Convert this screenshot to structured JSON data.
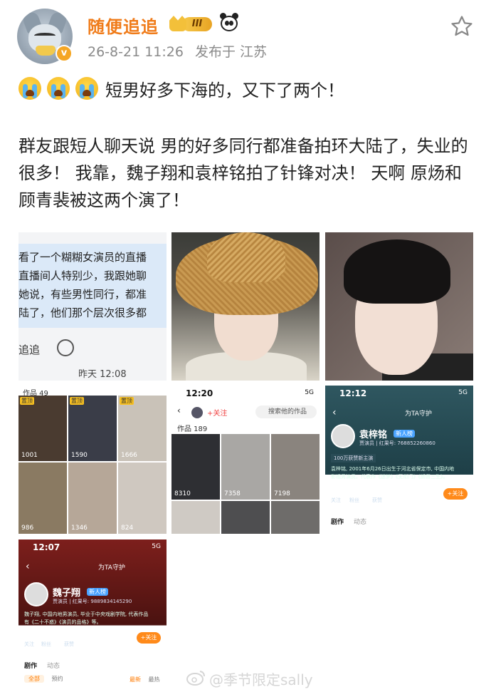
{
  "header": {
    "username": "随便追追",
    "level_badge": "III",
    "verified_badge": "v",
    "date": "26-8-21 11:26",
    "source": "发布于 江苏",
    "icons": [
      "avatar",
      "crown-badge",
      "panda-emoji",
      "star-icon"
    ]
  },
  "post": {
    "line1": "短男好多下海的，又下了两个！",
    "para1": "群友跟短人聊天说 男的好多同行都准备拍环大陆了，失业的很多！ 我靠，魏子翔和袁梓铭拍了针锋对决！ 天啊 原炀和顾青裴被这两个演了！",
    "emoji_count": 3
  },
  "chat_image": {
    "lines": [
      "看了一个糊糊女演员的直播",
      "直播间人特别少，我跟她聊",
      "她说，有些男性同行，都准",
      "陆了，他们那个层次很多都"
    ],
    "reply_text": "追追",
    "time": "昨天 12:08"
  },
  "grid1": {
    "header": "作品 49",
    "pin_label": "置顶",
    "counts": [
      "1001",
      "1590",
      "1666",
      "986",
      "1346",
      "824"
    ]
  },
  "grid2": {
    "status_time": "12:20",
    "status_right": "5G",
    "follow": "+关注",
    "search": "搜索他的作品",
    "header": "作品 189",
    "counts": [
      "8310",
      "7358",
      "7198"
    ]
  },
  "profile1": {
    "status_time": "12:12",
    "status_right": "5G",
    "guard": "为TA守护",
    "name": "袁梓铭",
    "badge": "新人榜",
    "id": "贾演员 | 红果号: 768852260860",
    "achievement": "100万获赞新主演",
    "info": "袁梓铭, 2001年6月26日出生于河北省保定市, 中国内地影视男演员。代表作《迷梦》《无衔门》《朗督三生》。",
    "stats": [
      {
        "value": "7",
        "label": "关注"
      },
      {
        "value": "5.3万",
        "label": "粉丝"
      },
      {
        "value": "1329.3万",
        "label": "获赞"
      }
    ],
    "follow_btn": "+关注",
    "tab_main": "剧作",
    "tab_second": "动态"
  },
  "profile2": {
    "status_time": "12:07",
    "status_right": "5G",
    "guard": "为TA守护",
    "name": "魏子翔",
    "badge": "新人榜",
    "id": "贾演员 | 红果号: 9889834145290",
    "info": "魏子翔, 中国内地男演员, 毕业于中央戏剧学院, 代表作品有《二十不惑》《演员的品格》等。",
    "stats": [
      {
        "value": "0",
        "label": "关注"
      },
      {
        "value": "3.2万",
        "label": "粉丝"
      },
      {
        "value": "416.3万",
        "label": "获赞"
      }
    ],
    "follow_btn": "+关注",
    "tab_main": "剧作",
    "tab_second": "动态",
    "filter_all": "全部",
    "filter_pre": "预约",
    "sort_new": "最新",
    "sort_hot": "最热"
  },
  "watermark": "@季节限定sally"
}
